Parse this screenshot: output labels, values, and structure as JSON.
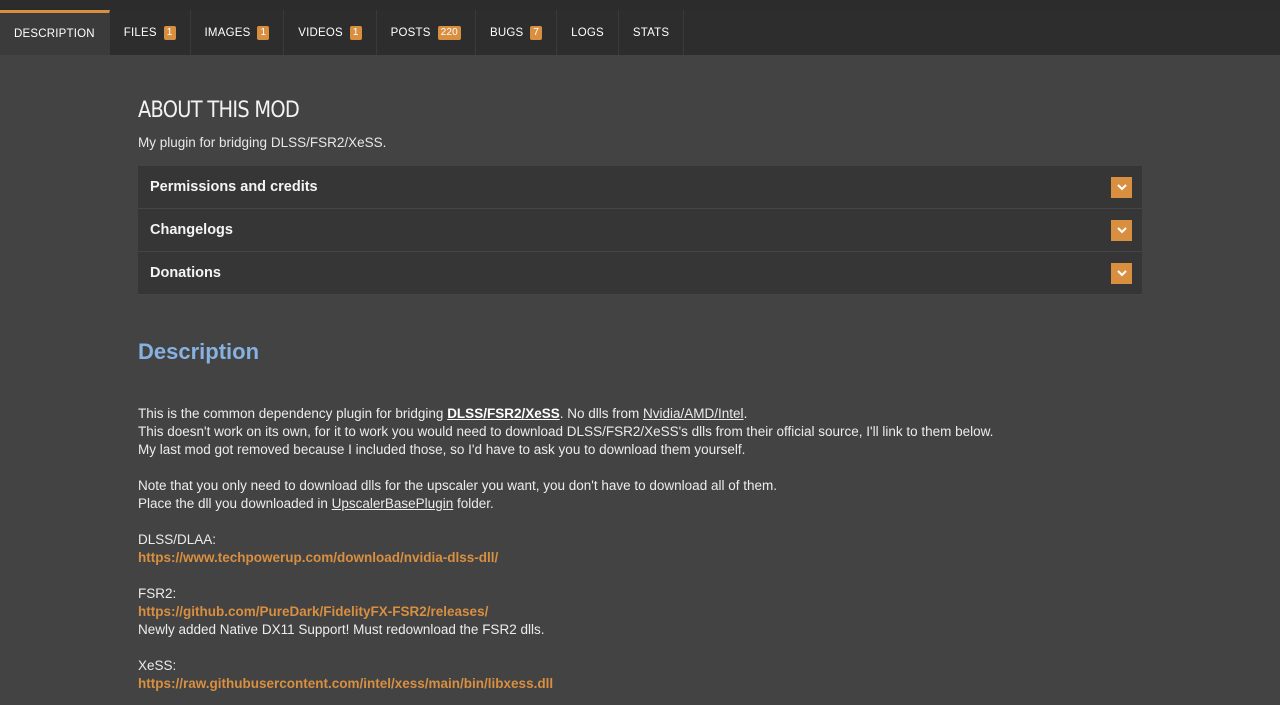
{
  "tabs": [
    {
      "label": "DESCRIPTION",
      "badge": null,
      "active": true
    },
    {
      "label": "FILES",
      "badge": "1"
    },
    {
      "label": "IMAGES",
      "badge": "1"
    },
    {
      "label": "VIDEOS",
      "badge": "1"
    },
    {
      "label": "POSTS",
      "badge": "220"
    },
    {
      "label": "BUGS",
      "badge": "7"
    },
    {
      "label": "LOGS",
      "badge": null
    },
    {
      "label": "STATS",
      "badge": null
    }
  ],
  "about": {
    "title": "ABOUT THIS MOD",
    "summary": "My plugin for bridging DLSS/FSR2/XeSS."
  },
  "accordion": [
    {
      "label": "Permissions and credits",
      "icon": "chevron-down-icon"
    },
    {
      "label": "Changelogs",
      "icon": "chevron-down-icon"
    },
    {
      "label": "Donations",
      "icon": "chevron-down-icon"
    }
  ],
  "description": {
    "heading": "Description",
    "p1_a": "This is the common dependency plugin for bridging ",
    "p1_link": "DLSS/FSR2/XeSS",
    "p1_b": ". No dlls from ",
    "p1_link2": "Nvidia/AMD/Intel",
    "p1_c": ".",
    "p2": "This doesn't work on its own, for it to work you would need to download DLSS/FSR2/XeSS's dlls from their official source, I'll link to them below.",
    "p3": "My last mod got removed because I included those, so I'd have to ask you to download them yourself.",
    "p4": "Note that you only need to download dlls for the upscaler you want, you don't have to download all of them.",
    "p5_a": "Place the dll you downloaded in ",
    "p5_link": "UpscalerBasePlugin",
    "p5_b": " folder.",
    "dlss_label": "DLSS/DLAA:",
    "dlss_url": "https://www.techpowerup.com/download/nvidia-dlss-dll/",
    "fsr_label": "FSR2:",
    "fsr_url": "https://github.com/PureDark/FidelityFX-FSR2/releases/",
    "fsr_note": "Newly added Native DX11 Support! Must redownload the FSR2 dlls.",
    "xess_label": "XeSS:",
    "xess_url": "https://raw.githubusercontent.com/intel/xess/main/bin/libxess.dll"
  },
  "colors": {
    "accent": "#d98f40",
    "heading_blue": "#86b1e0",
    "background": "#434343",
    "tabbar": "#2d2d2d"
  }
}
